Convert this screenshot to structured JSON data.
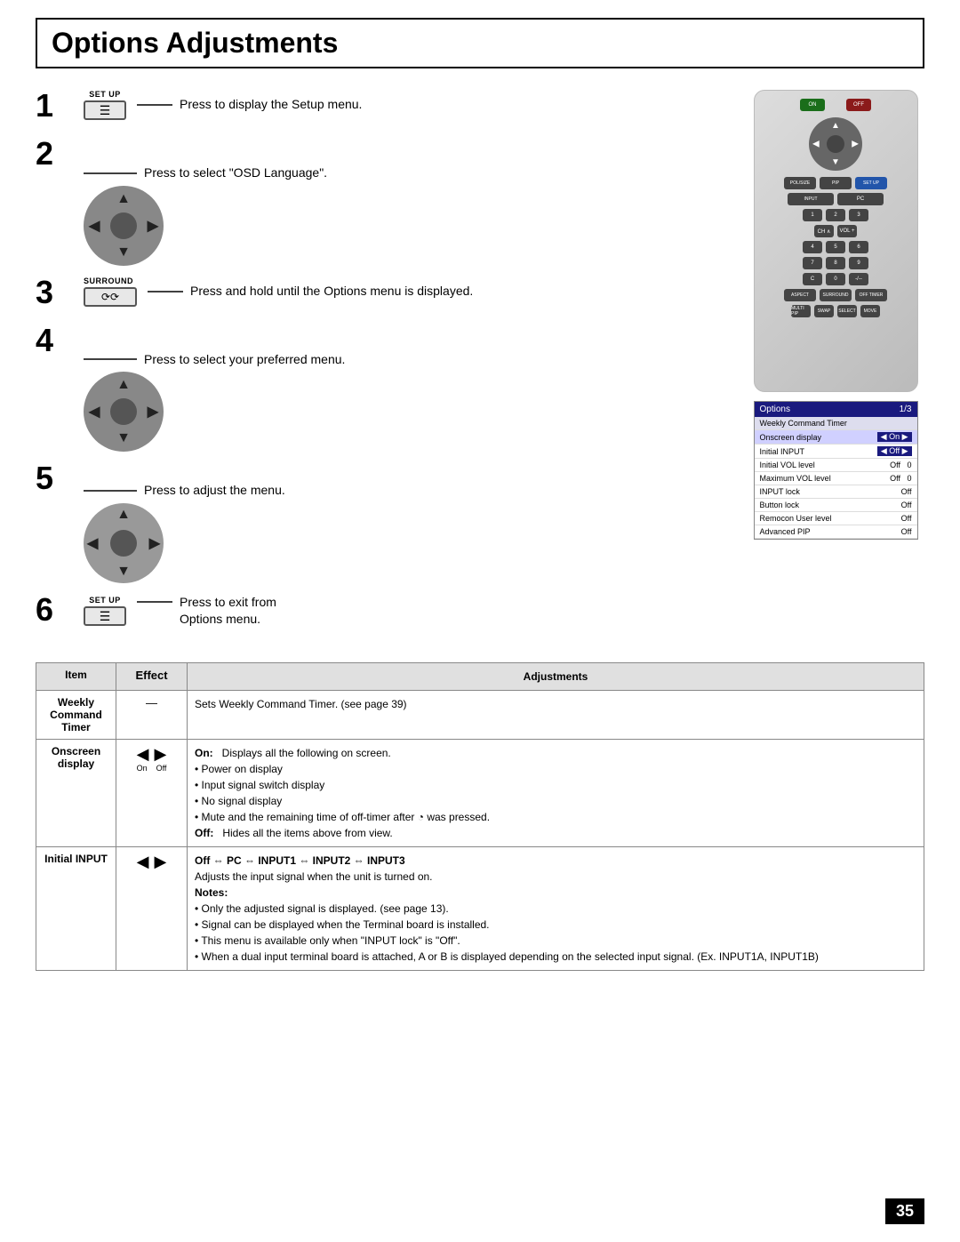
{
  "page": {
    "title": "Options Adjustments",
    "number": "35"
  },
  "steps": [
    {
      "number": "1",
      "button": "SET UP",
      "text": "Press to display the Setup menu."
    },
    {
      "number": "2",
      "text": "Press to select \"OSD Language\"."
    },
    {
      "number": "3",
      "button": "SURROUND",
      "text": "Press and hold until the Options menu is displayed."
    },
    {
      "number": "4",
      "text": "Press to select your preferred menu."
    },
    {
      "number": "5",
      "text": "Press to adjust the menu."
    },
    {
      "number": "6",
      "button": "SET UP",
      "text": "Press to exit from Options menu."
    }
  ],
  "options_menu": {
    "header": "Options",
    "page": "1/3",
    "rows": [
      {
        "label": "Weekly Command Timer",
        "value": "",
        "type": "title"
      },
      {
        "label": "Onscreen display",
        "value": "On",
        "type": "highlighted"
      },
      {
        "label": "Initial INPUT",
        "value": "Off",
        "type": "normal"
      },
      {
        "label": "Initial VOL level",
        "value": "Off  0",
        "type": "normal"
      },
      {
        "label": "Maximum VOL level",
        "value": "Off  0",
        "type": "normal"
      },
      {
        "label": "INPUT lock",
        "value": "Off",
        "type": "normal"
      },
      {
        "label": "Button lock",
        "value": "Off",
        "type": "normal"
      },
      {
        "label": "Remocon User level",
        "value": "Off",
        "type": "normal"
      },
      {
        "label": "Advanced PIP",
        "value": "Off",
        "type": "normal"
      }
    ]
  },
  "table": {
    "headers": [
      "Item",
      "Effect",
      "Adjustments"
    ],
    "rows": [
      {
        "item": "Weekly Command Timer",
        "effect": "—",
        "adjustments": "Sets Weekly Command Timer. (see page 39)"
      },
      {
        "item": "Onscreen display",
        "effect": "arrows",
        "on_label": "On",
        "off_label": "Off",
        "adjustments_bold_on": "On:",
        "adjustments_on": "   Displays all the following on screen.",
        "bullets_on": [
          "Power on display",
          "Input signal switch display",
          "No signal display",
          "Mute and the remaining time of off-timer after   was pressed."
        ],
        "adjustments_bold_off": "Off:",
        "adjustments_off": "   Hides all the items above from view."
      },
      {
        "item": "Initial INPUT",
        "effect": "arrows",
        "adjustments_sequence": "Off ⇔ PC ⇔ INPUT1 ⇔ INPUT2 ⇔ INPUT3",
        "adjustments_line2": "Adjusts the input signal when the unit is turned on.",
        "notes_label": "Notes:",
        "notes": [
          "Only the adjusted signal is displayed. (see page 13).",
          "Signal can be displayed when the Terminal board is installed.",
          "This menu is available only when \"INPUT lock\" is \"Off\".",
          "When a dual input terminal board is attached, A or B is displayed depending on the selected input signal. (Ex. INPUT1A, INPUT1B)"
        ]
      }
    ]
  }
}
